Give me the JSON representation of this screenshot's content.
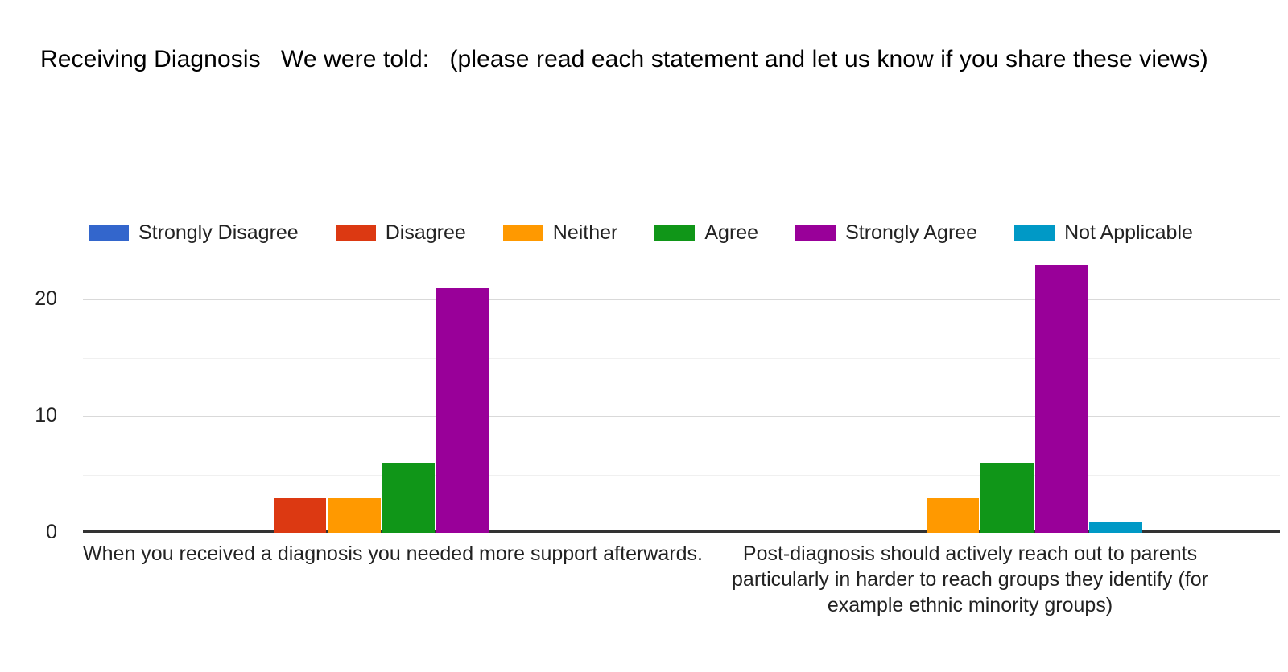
{
  "chart_data": {
    "type": "bar",
    "title": "Receiving Diagnosis   We were told:   (please read each statement and let us know if you share these views)",
    "xlabel": "",
    "ylabel": "",
    "ylim": [
      0,
      25
    ],
    "yticks": [
      0,
      10,
      20
    ],
    "ytick_labels": [
      "0",
      "10",
      "20"
    ],
    "minor_gridlines": [
      5,
      15
    ],
    "grid": true,
    "legend_position": "top",
    "categories": [
      "When you received a diagnosis you needed more support afterwards.",
      "Post-diagnosis should actively reach out to parents particularly in harder to reach groups they identify (for example ethnic minority groups)"
    ],
    "series": [
      {
        "name": "Strongly Disagree",
        "color": "#3366CC",
        "values": [
          0,
          0
        ]
      },
      {
        "name": "Disagree",
        "color": "#DC3912",
        "values": [
          3,
          0
        ]
      },
      {
        "name": "Neither",
        "color": "#FF9900",
        "values": [
          3,
          3
        ]
      },
      {
        "name": "Agree",
        "color": "#109618",
        "values": [
          6,
          6
        ]
      },
      {
        "name": "Strongly Agree",
        "color": "#990099",
        "values": [
          21,
          23
        ]
      },
      {
        "name": "Not Applicable",
        "color": "#0099C6",
        "values": [
          0,
          1
        ]
      }
    ]
  },
  "colors": {
    "background": "#ffffff",
    "text": "#222222",
    "axis_line": "#333333",
    "gridline_major": "#d9d9d9",
    "gridline_minor": "#f0f0f0"
  }
}
